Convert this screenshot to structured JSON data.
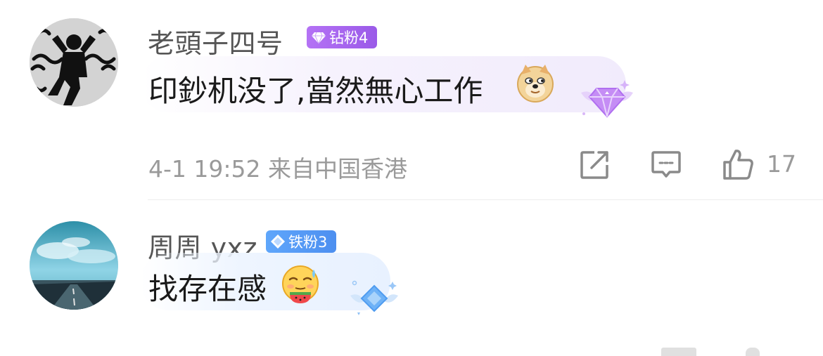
{
  "comments": [
    {
      "username": "老頭子四号",
      "badge": "钻粉4",
      "badge_color": "#a766f0",
      "text": "印鈔机没了,當然無心工作",
      "emoji": "doge-emoji",
      "decoration": "purple-diamond-wings",
      "meta": "4-1 19:52 来自中国香港",
      "like_count": "17"
    },
    {
      "username": "周周 yxz",
      "badge": "铁粉3",
      "badge_color": "#5a9cf8",
      "text": "找存在感",
      "emoji": "eating-watermelon-emoji",
      "decoration": "blue-diamond-wings"
    }
  ],
  "icons": {
    "share": "share-icon",
    "reply": "comment-icon",
    "like": "thumbs-up-icon"
  }
}
